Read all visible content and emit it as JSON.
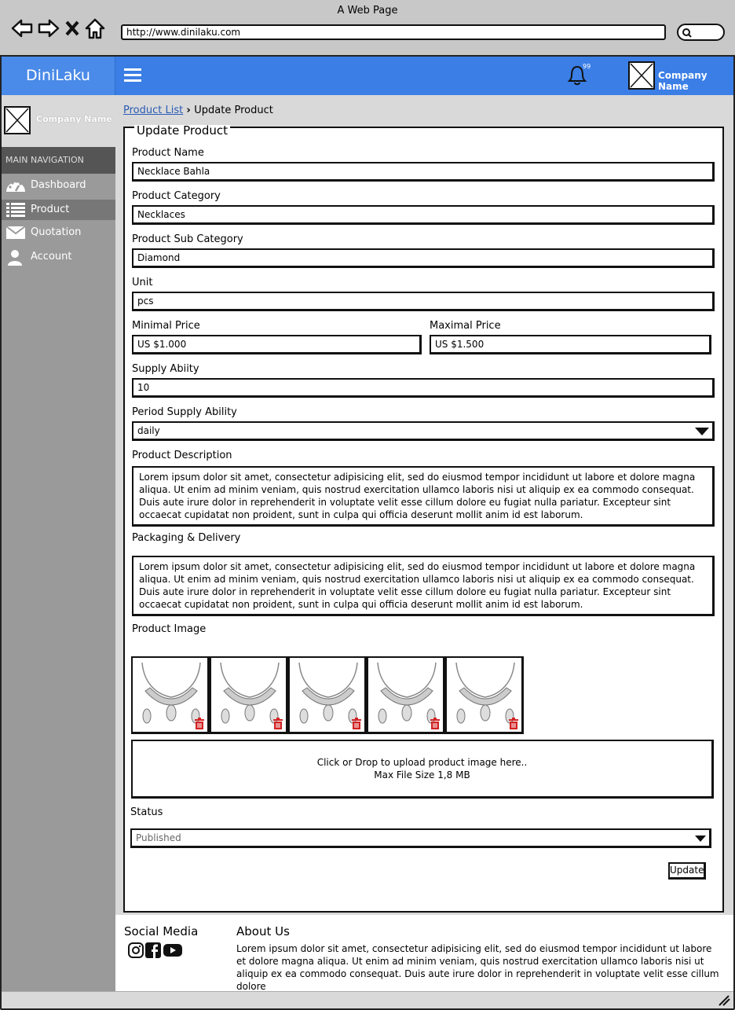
{
  "browser": {
    "title": "A Web Page",
    "url": "http://www.dinilaku.com"
  },
  "header": {
    "brand": "DiniLaku",
    "notification_count": "99",
    "company_name": "Company Name"
  },
  "sidebar": {
    "company_name": "Company Name",
    "section_title": "MAIN NAVIGATION",
    "items": [
      {
        "label": "Dashboard",
        "icon": "dashboard-icon"
      },
      {
        "label": "Product",
        "icon": "list-icon"
      },
      {
        "label": "Quotation",
        "icon": "envelope-icon"
      },
      {
        "label": "Account",
        "icon": "user-icon"
      }
    ]
  },
  "breadcrumb": {
    "link": "Product List",
    "current": "Update Product"
  },
  "form": {
    "title": "Update Product",
    "product_name_label": "Product Name",
    "product_name": "Necklace Bahla",
    "category_label": "Product Category",
    "category": "Necklaces",
    "sub_category_label": "Product Sub Category",
    "sub_category": "Diamond",
    "unit_label": "Unit",
    "unit": "pcs",
    "min_price_label": "Minimal Price",
    "min_price": "US $1.000",
    "max_price_label": "Maximal Price",
    "max_price": "US $1.500",
    "supply_label": "Supply Abiity",
    "supply": "10",
    "period_label": "Period Supply Ability",
    "period": "daily",
    "description_label": "Product Description",
    "description": "Lorem ipsum dolor sit amet, consectetur adipisicing elit, sed do eiusmod tempor incididunt ut labore et dolore magna aliqua. Ut enim ad minim veniam, quis nostrud exercitation ullamco laboris nisi ut aliquip ex ea commodo consequat. Duis aute irure dolor in reprehenderit in voluptate velit esse cillum dolore eu fugiat nulla pariatur. Excepteur sint occaecat cupidatat non proident, sunt in culpa qui officia deserunt mollit anim id est laborum.",
    "packaging_label": "Packaging & Delivery",
    "packaging": "Lorem ipsum dolor sit amet, consectetur adipisicing elit, sed do eiusmod tempor incididunt ut labore et dolore magna aliqua. Ut enim ad minim veniam, quis nostrud exercitation ullamco laboris nisi ut aliquip ex ea commodo consequat. Duis aute irure dolor in reprehenderit in voluptate velit esse cillum dolore eu fugiat nulla pariatur. Excepteur sint occaecat cupidatat non proident, sunt in culpa qui officia deserunt mollit anim id est laborum.",
    "image_label": "Product Image",
    "upload_line1": "Click or Drop to upload product image here..",
    "upload_line2": "Max File Size 1,8 MB",
    "status_label": "Status",
    "status": "Published",
    "update_button": "Update"
  },
  "footer": {
    "social_title": "Social Media",
    "about_title": "About Us",
    "about_text": "Lorem ipsum dolor sit amet, consectetur adipisicing elit, sed do eiusmod tempor incididunt ut labore et dolore magna aliqua. Ut enim ad minim veniam, quis nostrud exercitation ullamco laboris nisi ut aliquip ex ea commodo consequat. Duis aute irure dolor in reprehenderit in voluptate velit esse cillum dolore",
    "social_icons": [
      "instagram-icon",
      "facebook-icon",
      "youtube-icon"
    ]
  },
  "colors": {
    "header": "#3b7ee6",
    "sidebar": "#9a9a9a",
    "sidebar_header": "#555555",
    "delete": "#d22222"
  }
}
